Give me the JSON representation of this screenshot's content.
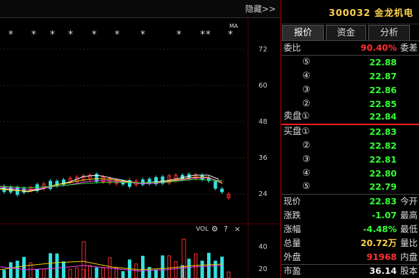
{
  "chart": {
    "hide_label": "隐藏>>",
    "ma_label": "MA",
    "vol_label": "VOL",
    "price_axis": [
      "72",
      "60",
      "48",
      "36",
      "24"
    ],
    "vol_axis": [
      "40",
      "20"
    ],
    "stars_count": 12
  },
  "panel": {
    "stock_code": "300032",
    "stock_name": "金龙机电",
    "tabs": [
      "报价",
      "资金",
      "分析"
    ],
    "weibi_label": "委比",
    "weibi_value": "90.40%",
    "weicha_label": "委差",
    "sell": [
      {
        "label": "⑤",
        "price": "22.88"
      },
      {
        "label": "④",
        "price": "22.87"
      },
      {
        "label": "③",
        "price": "22.86"
      },
      {
        "label": "②",
        "price": "22.85"
      },
      {
        "label": "卖盘①",
        "price": "22.84"
      }
    ],
    "buy": [
      {
        "label": "买盘①",
        "price": "22.83"
      },
      {
        "label": "②",
        "price": "22.82"
      },
      {
        "label": "③",
        "price": "22.81"
      },
      {
        "label": "④",
        "price": "22.80"
      },
      {
        "label": "⑤",
        "price": "22.79"
      }
    ],
    "stats": [
      {
        "label": "现价",
        "value": "22.83",
        "right": "今开",
        "color": "green"
      },
      {
        "label": "涨跌",
        "value": "-1.07",
        "right": "最高",
        "color": "green"
      },
      {
        "label": "涨幅",
        "value": "-4.48%",
        "right": "最低",
        "color": "green"
      },
      {
        "label": "总量",
        "value": "20.72万",
        "right": "量比",
        "color": "yellow"
      },
      {
        "label": "外盘",
        "value": "91968",
        "right": "内盘",
        "color": "red"
      },
      {
        "label": "市盈",
        "value": "36.14",
        "right": "股本",
        "color": "white"
      }
    ]
  }
}
